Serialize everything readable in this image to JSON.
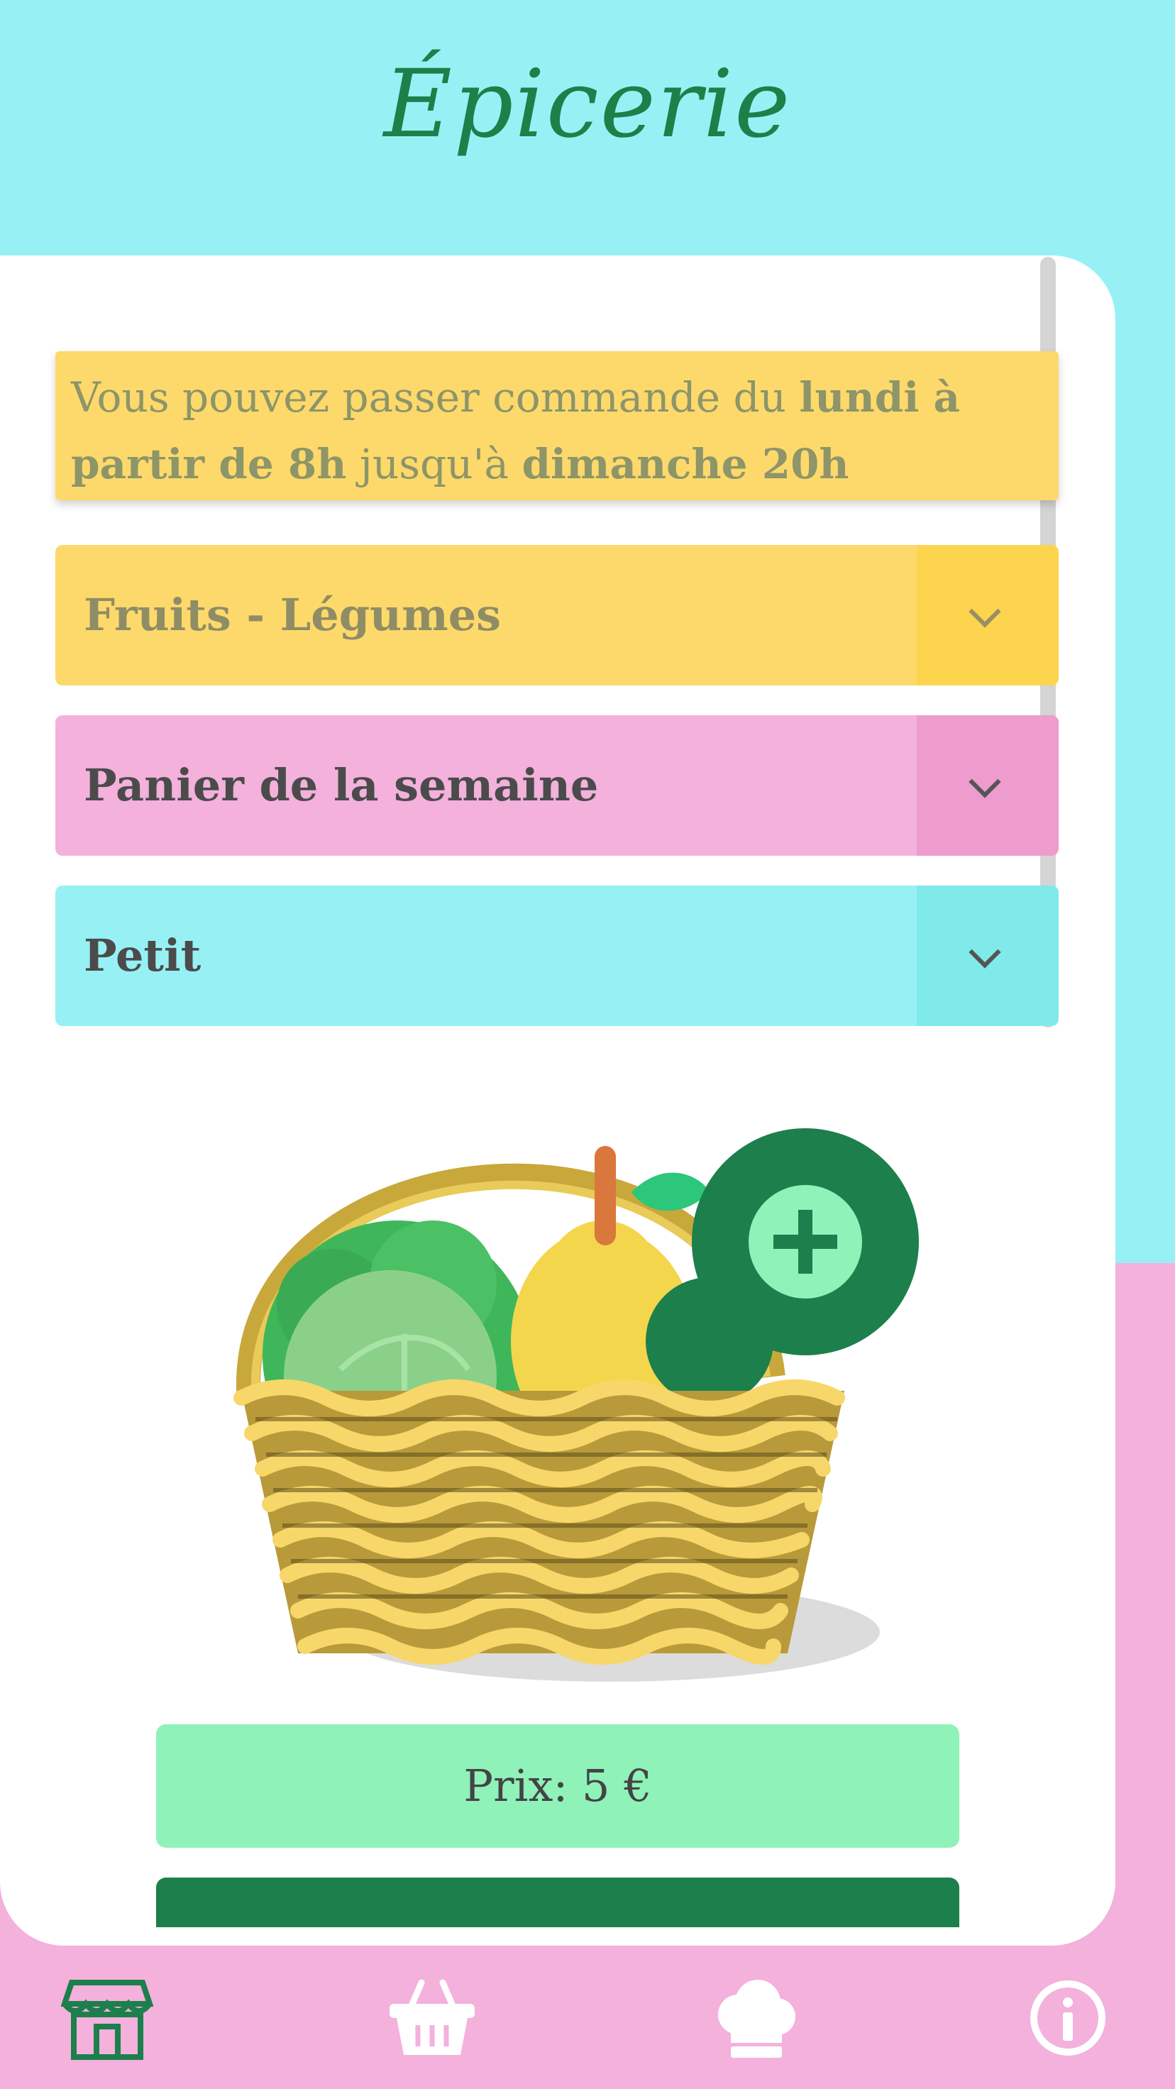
{
  "header": {
    "title": "Épicerie"
  },
  "notice": {
    "part1": "Vous pouvez passer commande du ",
    "bold1": "lundi à partir de 8h",
    "part2": " jusqu'à ",
    "bold2": "dimanche 20h"
  },
  "accordions": [
    {
      "label": "Fruits - Légumes",
      "color": "#fdd96b"
    },
    {
      "label": "Panier de la semaine",
      "color": "#f3b1dc"
    },
    {
      "label": "Petit",
      "color": "#97f1f4"
    }
  ],
  "product": {
    "image": "vegetable-basket-with-add-icon"
  },
  "price": {
    "label": "Prix: 5 €"
  },
  "nav": [
    {
      "icon": "shop-icon"
    },
    {
      "icon": "basket-icon"
    },
    {
      "icon": "chef-hat-icon"
    },
    {
      "icon": "info-icon"
    }
  ],
  "colors": {
    "cyan": "#97f1f4",
    "pink": "#f3b1dc",
    "yellow": "#fdd96b",
    "green": "#1c7f4c",
    "mint": "#8ff2b9"
  }
}
